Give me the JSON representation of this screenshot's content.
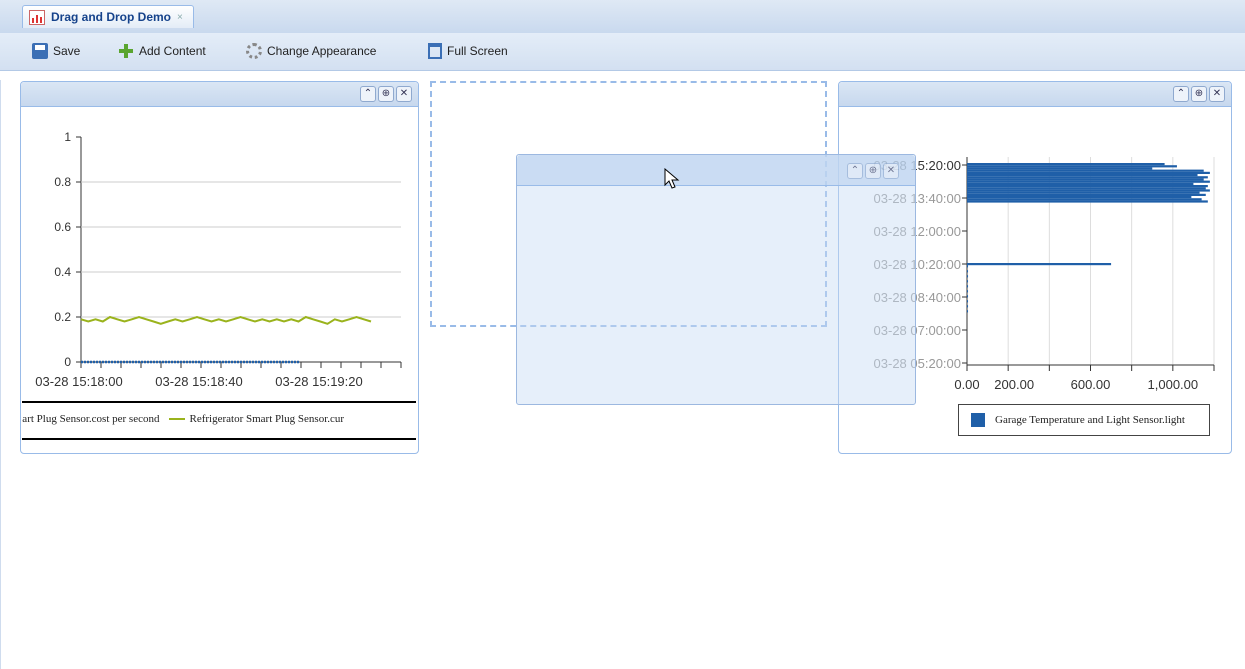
{
  "tab": {
    "title": "Drag and Drop Demo",
    "close": "×",
    "icon": "chart-icon"
  },
  "toolbar": {
    "save": "Save",
    "add_content": "Add Content",
    "change_appearance": "Change Appearance",
    "full_screen": "Full Screen"
  },
  "portlet_tools": {
    "collapse": "⌃",
    "settings": "⊕",
    "close": "✕"
  },
  "colors": {
    "line_series": "#9ab31c",
    "blue_series": "#1f5fa8",
    "header": "#c7d8ee",
    "border": "#99bbe8"
  },
  "chart_data": [
    {
      "type": "line",
      "title": "",
      "ylim": [
        0,
        1
      ],
      "yticks": [
        "0",
        "0.2",
        "0.4",
        "0.6",
        "0.8",
        "1"
      ],
      "xticks": [
        "03-28 15:18:00",
        "03-28 15:18:40",
        "03-28 15:19:20"
      ],
      "series": [
        {
          "name": "Refrigerator Smart Plug Sensor.current",
          "color": "#9ab31c",
          "values": [
            0.19,
            0.18,
            0.19,
            0.18,
            0.2,
            0.19,
            0.18,
            0.19,
            0.2,
            0.19,
            0.18,
            0.17,
            0.18,
            0.19,
            0.18,
            0.19,
            0.2,
            0.19,
            0.18,
            0.19,
            0.18,
            0.19,
            0.2,
            0.19,
            0.18,
            0.19,
            0.18,
            0.19,
            0.18,
            0.19,
            0.18,
            0.2,
            0.19,
            0.18,
            0.17,
            0.19,
            0.18,
            0.19,
            0.2,
            0.19,
            0.18
          ]
        },
        {
          "name": "Smart Plug Sensor.cost per second",
          "color": "#1f5fa8",
          "values": [
            0,
            0,
            0,
            0,
            0,
            0,
            0,
            0,
            0,
            0,
            0,
            0,
            0,
            0,
            0,
            0,
            0,
            0,
            0,
            0,
            0,
            0,
            0,
            0,
            0,
            0,
            0,
            0,
            0,
            0,
            0
          ]
        }
      ],
      "legend": [
        {
          "label": "e Smart Plug Sensor.cost per second",
          "color": "#1f5fa8"
        },
        {
          "label": "Refrigerator Smart Plug Sensor.cur",
          "color": "#9ab31c"
        }
      ]
    },
    {
      "type": "bar",
      "orientation": "horizontal",
      "xlim": [
        0,
        1200
      ],
      "xticks": [
        "0.00",
        "200.00",
        "600.00",
        "1,000.00"
      ],
      "yticks": [
        "03-28 15:20:00",
        "03-28 13:40:00",
        "03-28 12:00:00",
        "03-28 10:20:00",
        "03-28 08:40:00",
        "03-28 07:00:00",
        "03-28 05:20:00"
      ],
      "series": [
        {
          "name": "Garage Temperature and Light Sensor.light",
          "color": "#1f5fa8",
          "values": [
            960,
            1020,
            900,
            1150,
            1180,
            1120,
            1170,
            1150,
            1180,
            1100,
            1170,
            1160,
            1180,
            1130,
            1160,
            1090,
            1140,
            1170,
            700,
            5,
            5,
            5,
            5,
            5,
            5,
            5,
            5,
            5,
            5
          ]
        }
      ],
      "legend": [
        {
          "label": "Garage Temperature and Light Sensor.light",
          "color": "#1f5fa8"
        }
      ]
    }
  ]
}
